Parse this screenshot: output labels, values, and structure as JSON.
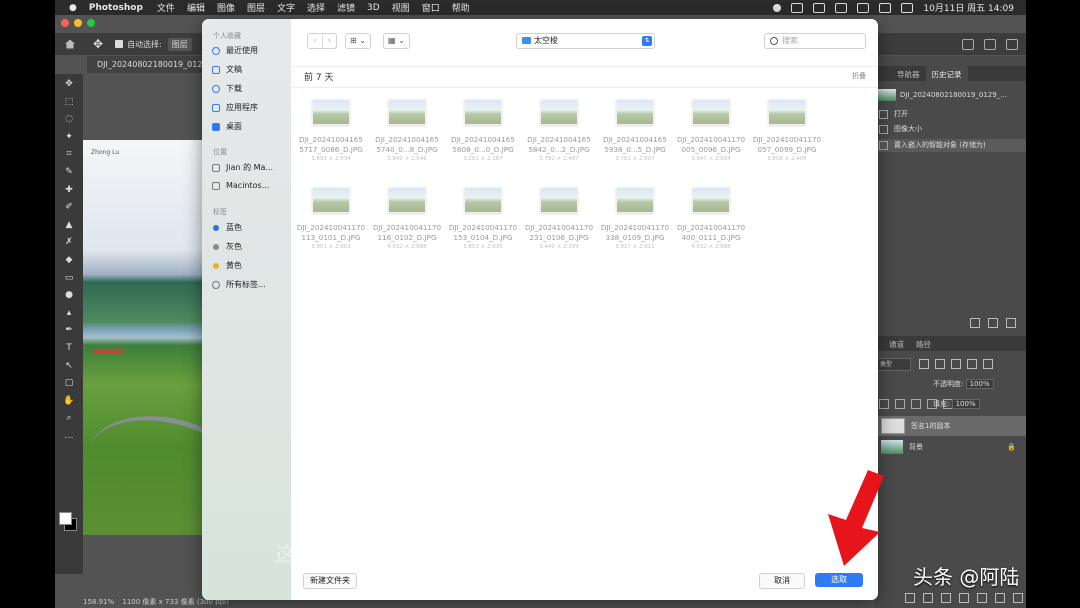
{
  "menubar": {
    "app_name": "Photoshop",
    "items": [
      "文件",
      "编辑",
      "图像",
      "图层",
      "文字",
      "选择",
      "滤镜",
      "3D",
      "视图",
      "窗口",
      "帮助"
    ],
    "clock": "10月11日 周五 14:09"
  },
  "options_bar": {
    "auto_select_label": "自动选择:",
    "auto_select_value": "图层"
  },
  "document": {
    "tab_title": "DJI_20240802180019_012",
    "watermark_text": "Zhong Lu",
    "zoom": "158.91%",
    "size_info": "1100 像素 x 733 像素 (300 ppi)"
  },
  "panels": {
    "tabs": [
      "导航器",
      "历史记录"
    ],
    "history_snapshot": "DJI_20240802180019_0129_...",
    "history_items": [
      "打开",
      "图像大小",
      "置入嵌入的智能对象 (存储为)"
    ],
    "layer_tabs": [
      "通道",
      "路径"
    ],
    "kind_label": "类型",
    "opacity_label": "不透明度:",
    "opacity_value": "100%",
    "fill_label": "填充:",
    "fill_value": "100%",
    "layers": [
      "签名1的副本",
      "背景"
    ]
  },
  "dialog": {
    "sidebar": {
      "favorites_header": "个人收藏",
      "favorites": [
        "最近使用",
        "文稿",
        "下载",
        "应用程序",
        "桌面"
      ],
      "locations_header": "位置",
      "locations": [
        "Jian 的 Ma...",
        "Macintos..."
      ],
      "tags_header": "标签",
      "tags": [
        {
          "label": "蓝色",
          "color": "#2f6fe0"
        },
        {
          "label": "灰色",
          "color": "#8a8a8a"
        },
        {
          "label": "黄色",
          "color": "#e8b21c"
        },
        {
          "label": "所有标签..."
        }
      ]
    },
    "path": "太空梭",
    "search_placeholder": "搜索",
    "group_title": "前 7 天",
    "collapse_label": "折叠",
    "files": [
      {
        "name1": "DJI_20241004165",
        "name2": "5717_0086_D.JPG",
        "dim": "3,891 × 2,534"
      },
      {
        "name1": "DJI_20241004165",
        "name2": "5740_0...8_D.JPG",
        "dim": "3,849 × 2,646"
      },
      {
        "name1": "DJI_20241004165",
        "name2": "5808_0...0_D.JPG",
        "dim": "3,261 × 2,167"
      },
      {
        "name1": "DJI_20241004165",
        "name2": "5842_0...2_D.JPG",
        "dim": "3,792 × 2,487"
      },
      {
        "name1": "DJI_20241004165",
        "name2": "5938_0...5_D.JPG",
        "dim": "3,761 × 2,507"
      },
      {
        "name1": "DJI_202410041170",
        "name2": "005_0096_D.JPG",
        "dim": "3,947 × 2,604"
      },
      {
        "name1": "DJI_202410041170",
        "name2": "057_0099_D.JPG",
        "dim": "3,658 × 2,405"
      },
      {
        "name1": "DJI_202410041170",
        "name2": "113_0101_D.JPG",
        "dim": "3,901 × 2,601"
      },
      {
        "name1": "DJI_202410041170",
        "name2": "116_0102_D.JPG",
        "dim": "4,032 × 2,688"
      },
      {
        "name1": "DJI_202410041170",
        "name2": "153_0104_D.JPG",
        "dim": "3,853 × 2,635"
      },
      {
        "name1": "DJI_202410041170",
        "name2": "231_0106_D.JPG",
        "dim": "3,449 × 2,299"
      },
      {
        "name1": "DJI_202410041170",
        "name2": "338_0109_D.JPG",
        "dim": "3,917 × 2,611"
      },
      {
        "name1": "DJI_202410041170",
        "name2": "400_0111_D.JPG",
        "dim": "4,032 × 2,688"
      }
    ],
    "new_folder_label": "新建文件夹",
    "cancel_label": "取消",
    "choose_label": "选取"
  },
  "overlays": {
    "subtitle_char": "这",
    "watermark": "头条 @阿陆"
  },
  "colors": {
    "accent": "#2f7bf6",
    "arrow": "#e8141c"
  }
}
